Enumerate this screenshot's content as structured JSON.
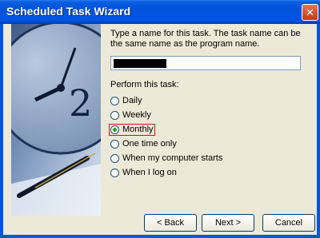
{
  "window": {
    "title": "Scheduled Task Wizard",
    "close_glyph": "✕"
  },
  "form": {
    "instruction": "Type a name for this task.  The task name can be the same name as the program name.",
    "task_name_value": "",
    "perform_label": "Perform this task:",
    "options": [
      {
        "label": "Daily",
        "checked": false
      },
      {
        "label": "Weekly",
        "checked": false
      },
      {
        "label": "Monthly",
        "checked": true
      },
      {
        "label": "One time only",
        "checked": false
      },
      {
        "label": "When my computer starts",
        "checked": false
      },
      {
        "label": "When I log on",
        "checked": false
      }
    ]
  },
  "buttons": {
    "back": "< Back",
    "next": "Next >",
    "cancel": "Cancel"
  }
}
